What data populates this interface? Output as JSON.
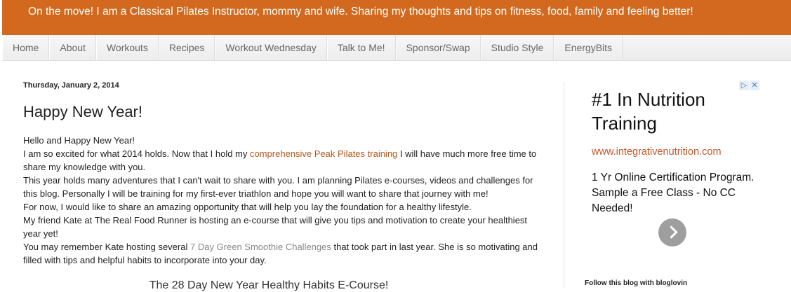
{
  "header": {
    "description": "On the move! I am a Classical Pilates Instructor, mommy and wife. Sharing my thoughts and tips on fitness, food, family and feeling better!"
  },
  "nav": {
    "tabs": [
      {
        "label": "Home"
      },
      {
        "label": "About"
      },
      {
        "label": "Workouts"
      },
      {
        "label": "Recipes"
      },
      {
        "label": "Workout Wednesday"
      },
      {
        "label": "Talk to Me!"
      },
      {
        "label": "Sponsor/Swap"
      },
      {
        "label": "Studio Style"
      },
      {
        "label": "EnergyBits"
      }
    ]
  },
  "post": {
    "date": "Thursday, January 2, 2014",
    "title": "Happy New Year!",
    "greeting": "Hello and Happy New Year!",
    "p1_before": "I am so excited for what 2014 holds.  Now that I hold my ",
    "p1_link": "comprehensive Peak Pilates training",
    "p1_after": " I will have much more free time to share my knowledge with you.",
    "p2": "This year holds many adventures that I can't wait to share with you.  I am planning Pilates e-courses, videos and challenges for this blog.  Personally I will  be training for my first-ever triathlon and hope you will want to share that journey with me!",
    "p3": "For now, I would like to share an amazing opportunity that will help you lay the foundation for a healthy lifestyle.",
    "p4": "My friend Kate at The Real Food Runner is hosting an e-course that will give you tips and motivation to create your healthiest year yet!",
    "p5_before": "You may remember Kate hosting several ",
    "p5_link": "7 Day Green Smoothie Challenges",
    "p5_after": " that took part in last year.  She is so motivating and filled with tips and helpful habits to incorporate into your day.",
    "subhead": "The 28 Day New Year Healthy Habits E-Course!"
  },
  "ad": {
    "title": "#1 In Nutrition Training",
    "url": "www.integrativenutrition.com",
    "body": "1 Yr Online Certification Program. Sample a Free Class - No CC Needed!",
    "info_icon": "▷",
    "close_icon": "✕"
  },
  "sidebar": {
    "follow_text": "Follow this blog with bloglovin"
  },
  "colors": {
    "header_bg": "#d2691e",
    "link": "#b4581d",
    "ad_url": "#c0582a"
  }
}
